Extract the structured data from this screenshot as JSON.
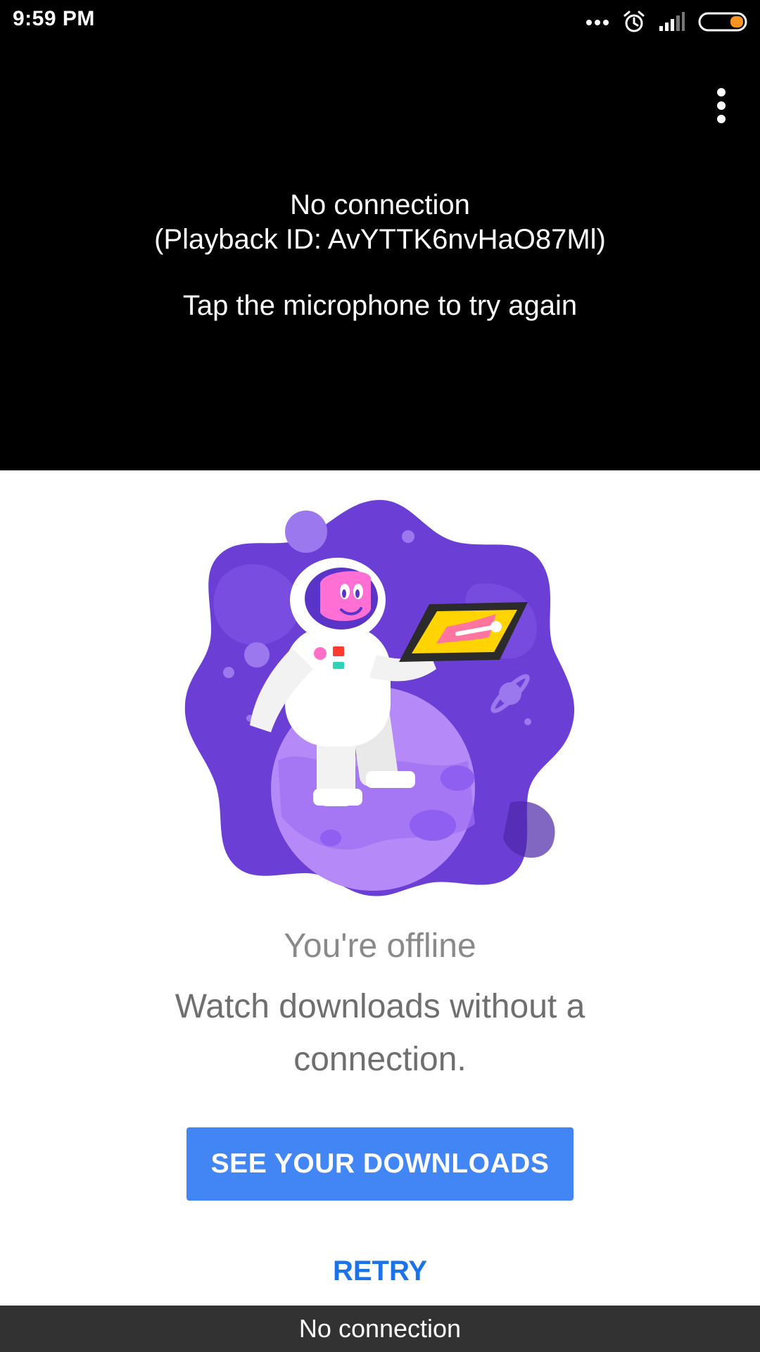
{
  "status_bar": {
    "time": "9:59 PM",
    "icons": [
      "more-dots-icon",
      "alarm-clock-icon",
      "signal-strength-icon",
      "battery-icon"
    ],
    "battery_color": "#f7931e"
  },
  "player": {
    "message_line1": "No connection",
    "message_line2": "(Playback ID: AvYTTK6nvHaO87Ml)",
    "hint": "Tap the microphone to try again",
    "menu_icon": "vertical-dots-icon"
  },
  "offline": {
    "illustration": "astronaut-on-planet-illustration",
    "title": "You're offline",
    "subtitle": "Watch downloads without a connection.",
    "downloads_button": "SEE YOUR DOWNLOADS",
    "retry_button": "RETRY"
  },
  "snackbar": {
    "text": "No connection"
  },
  "colors": {
    "primary_button": "#4285f4",
    "link": "#1a73e8",
    "player_background": "#000000",
    "snackbar_background": "#323232",
    "illustration_purple": "#6b3fd6"
  }
}
